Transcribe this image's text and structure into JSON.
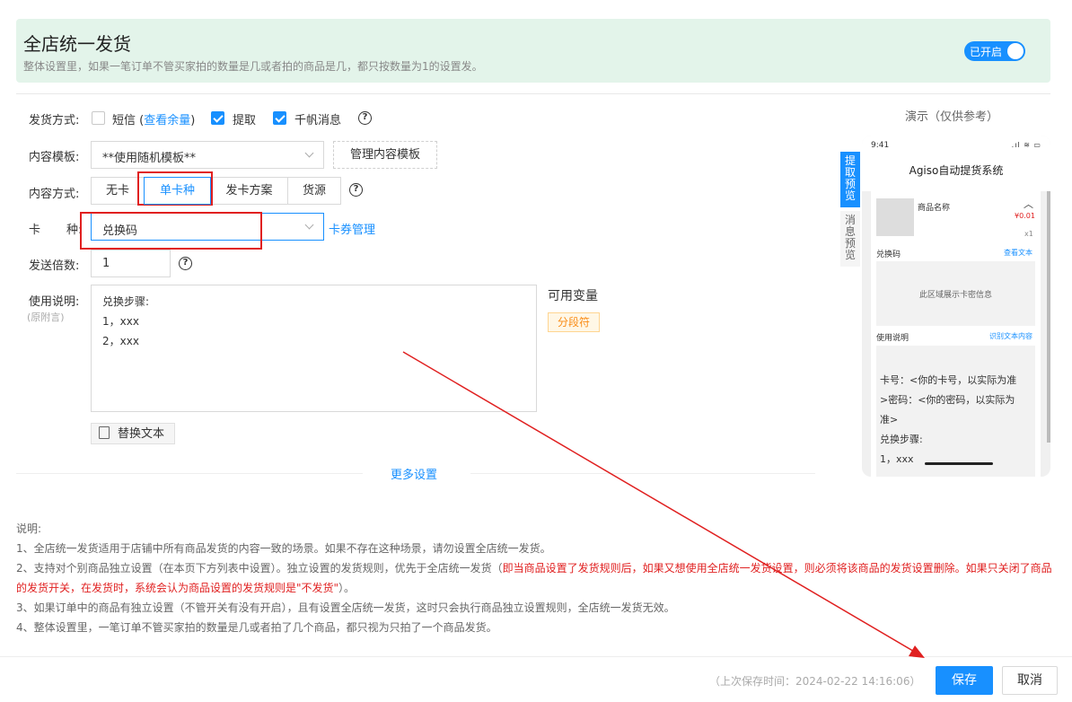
{
  "banner": {
    "title": "全店统一发货",
    "subtitle": "整体设置里，如果一笔订单不管买家拍的数量是几或者拍的商品是几，都只按数量为1的设置发。",
    "toggle_label": "已开启",
    "toggle_on": true
  },
  "form": {
    "send_method": {
      "label": "发货方式:",
      "options": [
        {
          "label": "短信",
          "checked": false
        },
        {
          "label": "提取",
          "checked": true
        },
        {
          "label": "千帆消息",
          "checked": true
        }
      ],
      "sms_link": "查看余量",
      "sms_paren_open": "(",
      "sms_paren_close": ")"
    },
    "content_template": {
      "label": "内容模板:",
      "value": "**使用随机模板**",
      "manage_button": "管理内容模板"
    },
    "content_mode": {
      "label": "内容方式:",
      "options": [
        "无卡",
        "单卡种",
        "发卡方案",
        "货源"
      ],
      "selected": "单卡种"
    },
    "card_type": {
      "label_a": "卡",
      "label_b": "种:",
      "value": "兑换码",
      "manage_link": "卡券管理"
    },
    "send_multiple": {
      "label": "发送倍数:",
      "value": "1"
    },
    "usage": {
      "label": "使用说明:",
      "sub_label": "(原附言)",
      "lines": [
        "兑换步骤:",
        "1，xxx",
        "2，xxx"
      ],
      "replace_button": "替换文本"
    },
    "variables": {
      "title": "可用变量",
      "tag": "分段符"
    },
    "more_settings": "更多设置"
  },
  "notes": {
    "title": "说明:",
    "item1": "1、全店统一发货适用于店铺中所有商品发货的内容一致的场景。如果不存在这种场景，请勿设置全店统一发货。",
    "item2_a": "2、支持对个别商品独立设置（在本页下方列表中设置）。独立设置的发货规则，优先于全店统一发货（",
    "item2_red": "即当商品设置了发货规则后，如果又想使用全店统一发货设置，则必须将该商品的发货设置删除。如果只关闭了商品的发货开关，在发货时，系统会认为商品设置的发货规则是\"不发货\"",
    "item2_b": "）。",
    "item3": "3、如果订单中的商品有独立设置（不管开关有没有开启），且有设置全店统一发货，这时只会执行商品独立设置规则，全店统一发货无效。",
    "item4": "4、整体设置里，一笔订单不管买家拍的数量是几或者拍了几个商品，都只视为只拍了一个商品发货。"
  },
  "demo": {
    "title": "演示（仅供参考）",
    "tabs": [
      "提取预览",
      "消息预览"
    ],
    "phone": {
      "time": "9:41",
      "app_title": "Agiso自动提货系统",
      "product_name": "商品名称",
      "price": "¥0.01",
      "qty": "x1",
      "code_label": "兑换码",
      "view_text": "查看文本",
      "card_area_text": "此区域展示卡密信息",
      "usage_label": "使用说明",
      "recognize_text": "识别文本内容",
      "usage_lines": [
        "卡号：<你的卡号，以实际为准",
        ">密码：<你的密码，以实际为",
        "准>",
        "兑换步骤:",
        "1，xxx"
      ]
    }
  },
  "footer": {
    "save_time": "（上次保存时间：2024-02-22 14:16:06）",
    "save_button": "保存",
    "cancel_button": "取消"
  },
  "colors": {
    "accent": "#1890ff",
    "banner_bg": "#e3f4ea",
    "annotation_red": "#e02020",
    "tag_orange": "#fa8c16"
  }
}
